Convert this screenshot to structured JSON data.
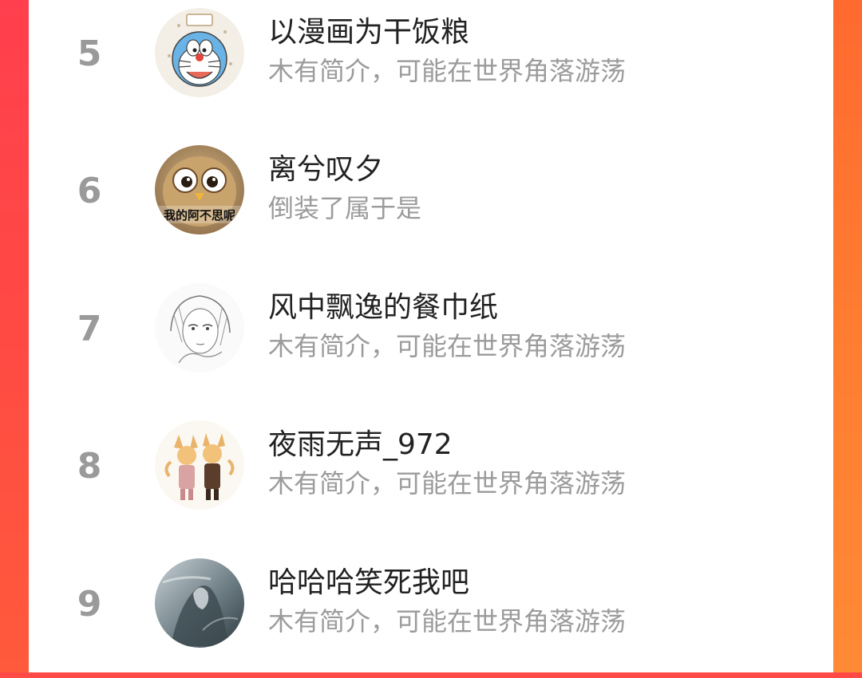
{
  "ranking": {
    "items": [
      {
        "rank": "5",
        "name": "以漫画为干饭粮",
        "bio": "木有简介，可能在世界角落游荡",
        "avatar_icon": "doraemon-avatar-icon"
      },
      {
        "rank": "6",
        "name": "离兮叹夕",
        "bio": "倒装了属于是",
        "avatar_icon": "cartoon-bird-avatar-icon",
        "avatar_caption": "我的阿不思呢"
      },
      {
        "rank": "7",
        "name": "风中飘逸的餐巾纸",
        "bio": "木有简介，可能在世界角落游荡",
        "avatar_icon": "sketch-portrait-avatar-icon"
      },
      {
        "rank": "8",
        "name": "夜雨无声_972",
        "bio": "木有简介，可能在世界角落游荡",
        "avatar_icon": "fox-characters-avatar-icon"
      },
      {
        "rank": "9",
        "name": "哈哈哈笑死我吧",
        "bio": "木有简介，可能在世界角落游荡",
        "avatar_icon": "misty-figure-avatar-icon"
      }
    ]
  }
}
